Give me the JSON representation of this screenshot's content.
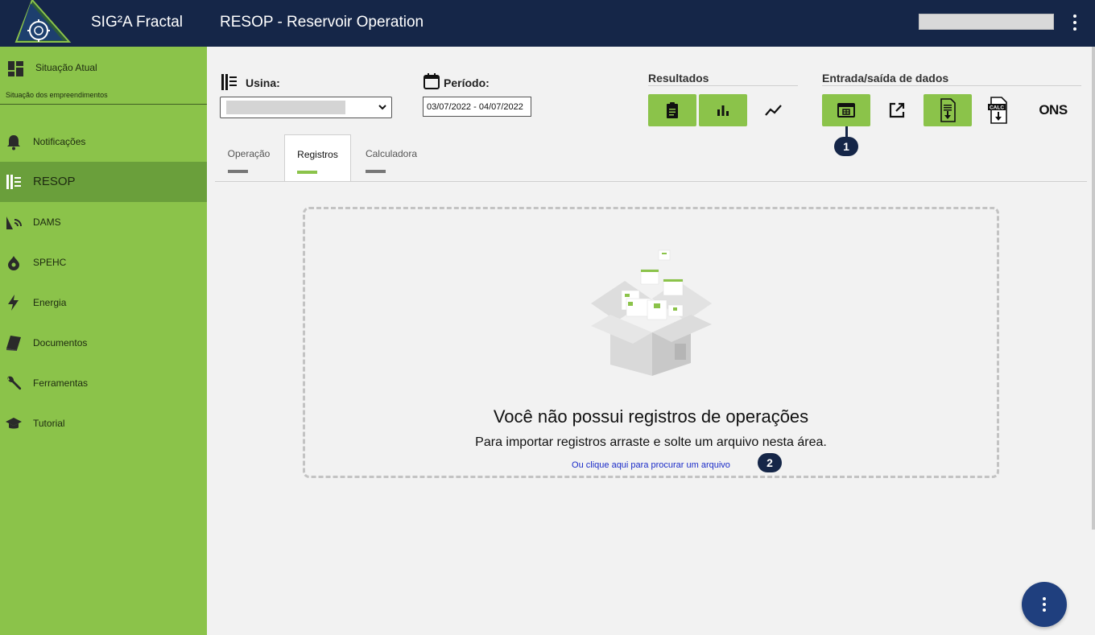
{
  "header": {
    "app_title": "SIG²A Fractal",
    "page_title": "RESOP - Reservoir Operation"
  },
  "sidebar": {
    "top_item": {
      "label": "Situação Atual",
      "subtitle": "Situação dos empreendimentos",
      "icon": "dashboard-icon"
    },
    "items": [
      {
        "label": "Notificações",
        "icon": "bell-icon",
        "active": false
      },
      {
        "label": "RESOP",
        "icon": "dam-icon",
        "active": true
      },
      {
        "label": "DAMS",
        "icon": "signal-icon",
        "active": false
      },
      {
        "label": "SPEHC",
        "icon": "water-drop-icon",
        "active": false
      },
      {
        "label": "Energia",
        "icon": "lightning-icon",
        "active": false
      },
      {
        "label": "Documentos",
        "icon": "book-icon",
        "active": false
      },
      {
        "label": "Ferramentas",
        "icon": "wrench-icon",
        "active": false
      },
      {
        "label": "Tutorial",
        "icon": "graduation-cap-icon",
        "active": false
      }
    ]
  },
  "filters": {
    "usina_label": "Usina:",
    "periodo_label": "Período:",
    "periodo_value": "03/07/2022 - 04/07/2022"
  },
  "resultados": {
    "title": "Resultados",
    "buttons": [
      "clipboard-icon",
      "bar-chart-icon",
      "trend-line-icon"
    ]
  },
  "entrada_saida": {
    "title": "Entrada/saída de dados",
    "buttons": [
      "table-window-icon",
      "open-external-icon",
      "file-download-icon",
      "calc-download-icon",
      "ons-logo"
    ],
    "ons_text": "ONS"
  },
  "markers": {
    "one": "1",
    "two": "2"
  },
  "tabs": [
    {
      "label": "Operação",
      "active": false
    },
    {
      "label": "Registros",
      "active": true
    },
    {
      "label": "Calculadora",
      "active": false
    }
  ],
  "dropzone": {
    "title": "Você não possui registros de operações",
    "subtitle": "Para importar registros arraste e solte um arquivo nesta área.",
    "link": "Ou clique aqui para procurar um arquivo"
  },
  "colors": {
    "header_bg": "#152648",
    "sidebar_bg": "#8bc34a",
    "sidebar_active": "#6a9f3b",
    "accent": "#8bc34a",
    "fab": "#1f3f7e"
  }
}
